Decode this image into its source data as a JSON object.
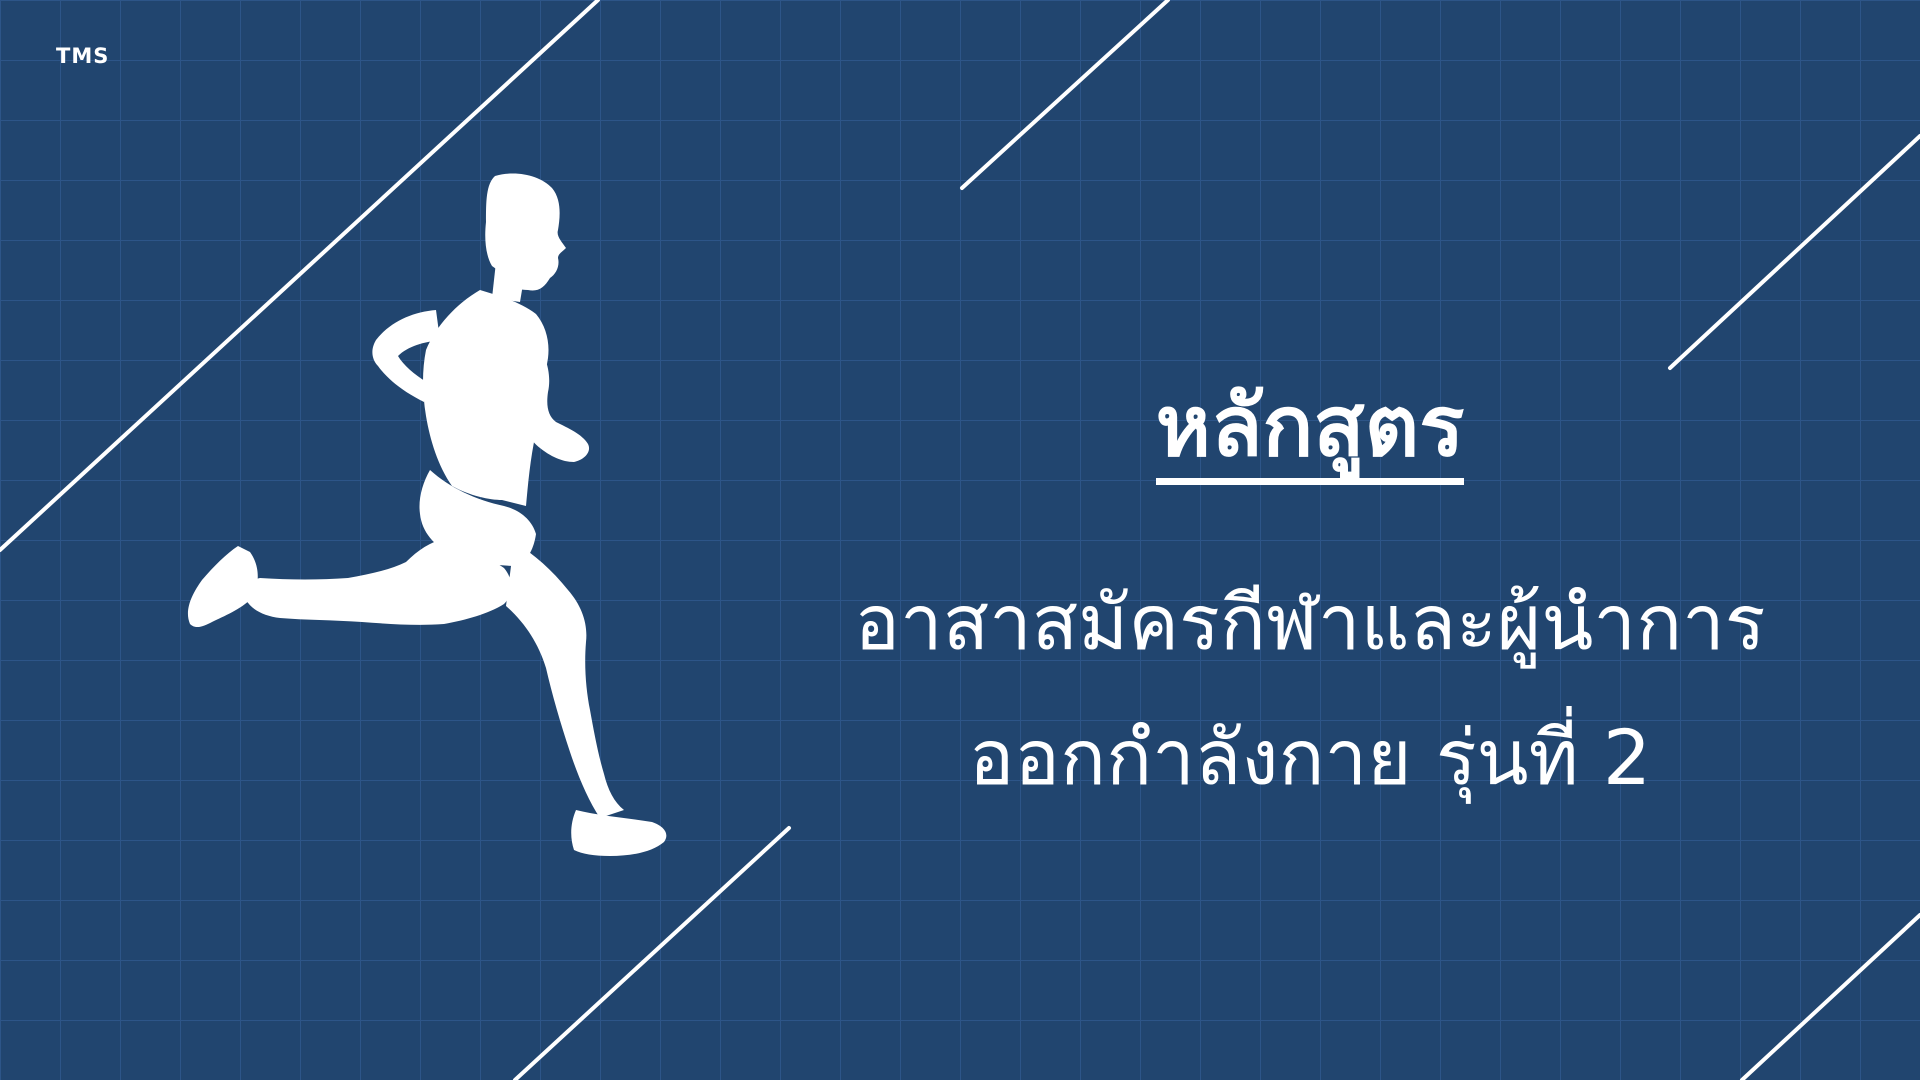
{
  "brand": {
    "logo_text": "TMS"
  },
  "title": {
    "label": "หลักสูตร",
    "line1": "อาสาสมัครกีฬาและผู้นำการ",
    "line2": "ออกกำลังกาย รุ่นที่ 2"
  },
  "colors": {
    "background": "#21456f",
    "grid": "#2c5485",
    "accent_lines": "#ffffff",
    "text": "#ffffff"
  },
  "illustration": {
    "icon": "running-man-silhouette-icon"
  }
}
